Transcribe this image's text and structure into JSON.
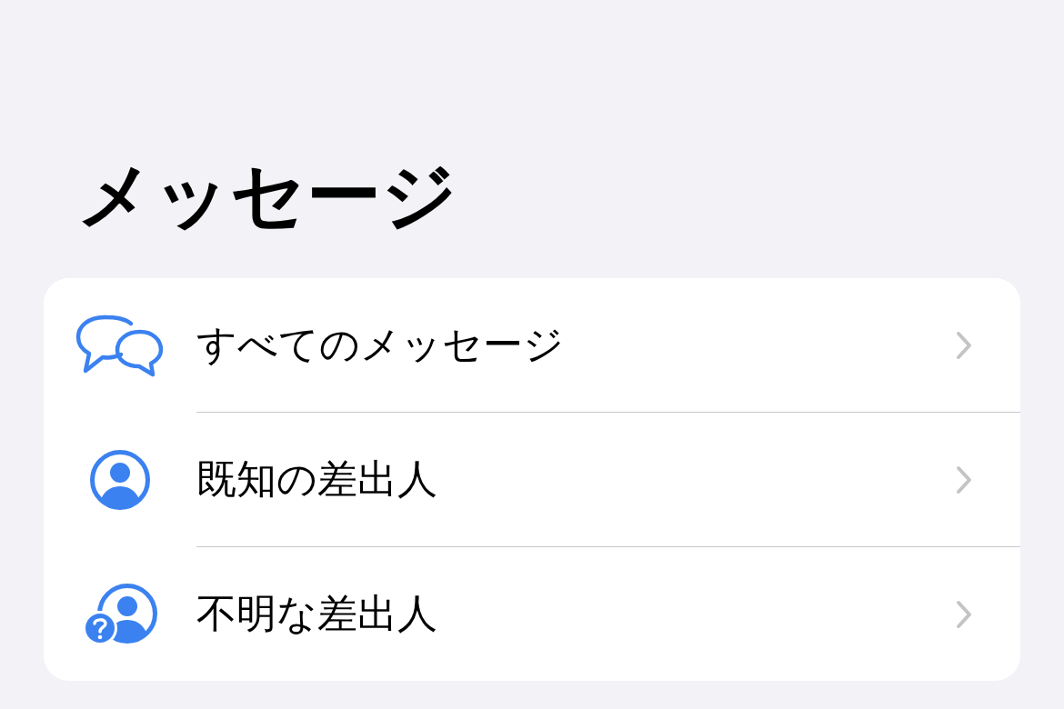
{
  "title": "メッセージ",
  "items": [
    {
      "label": "すべてのメッセージ",
      "kind": "chat"
    },
    {
      "label": "既知の差出人",
      "kind": "person"
    },
    {
      "label": "不明な差出人",
      "kind": "unknown"
    }
  ]
}
